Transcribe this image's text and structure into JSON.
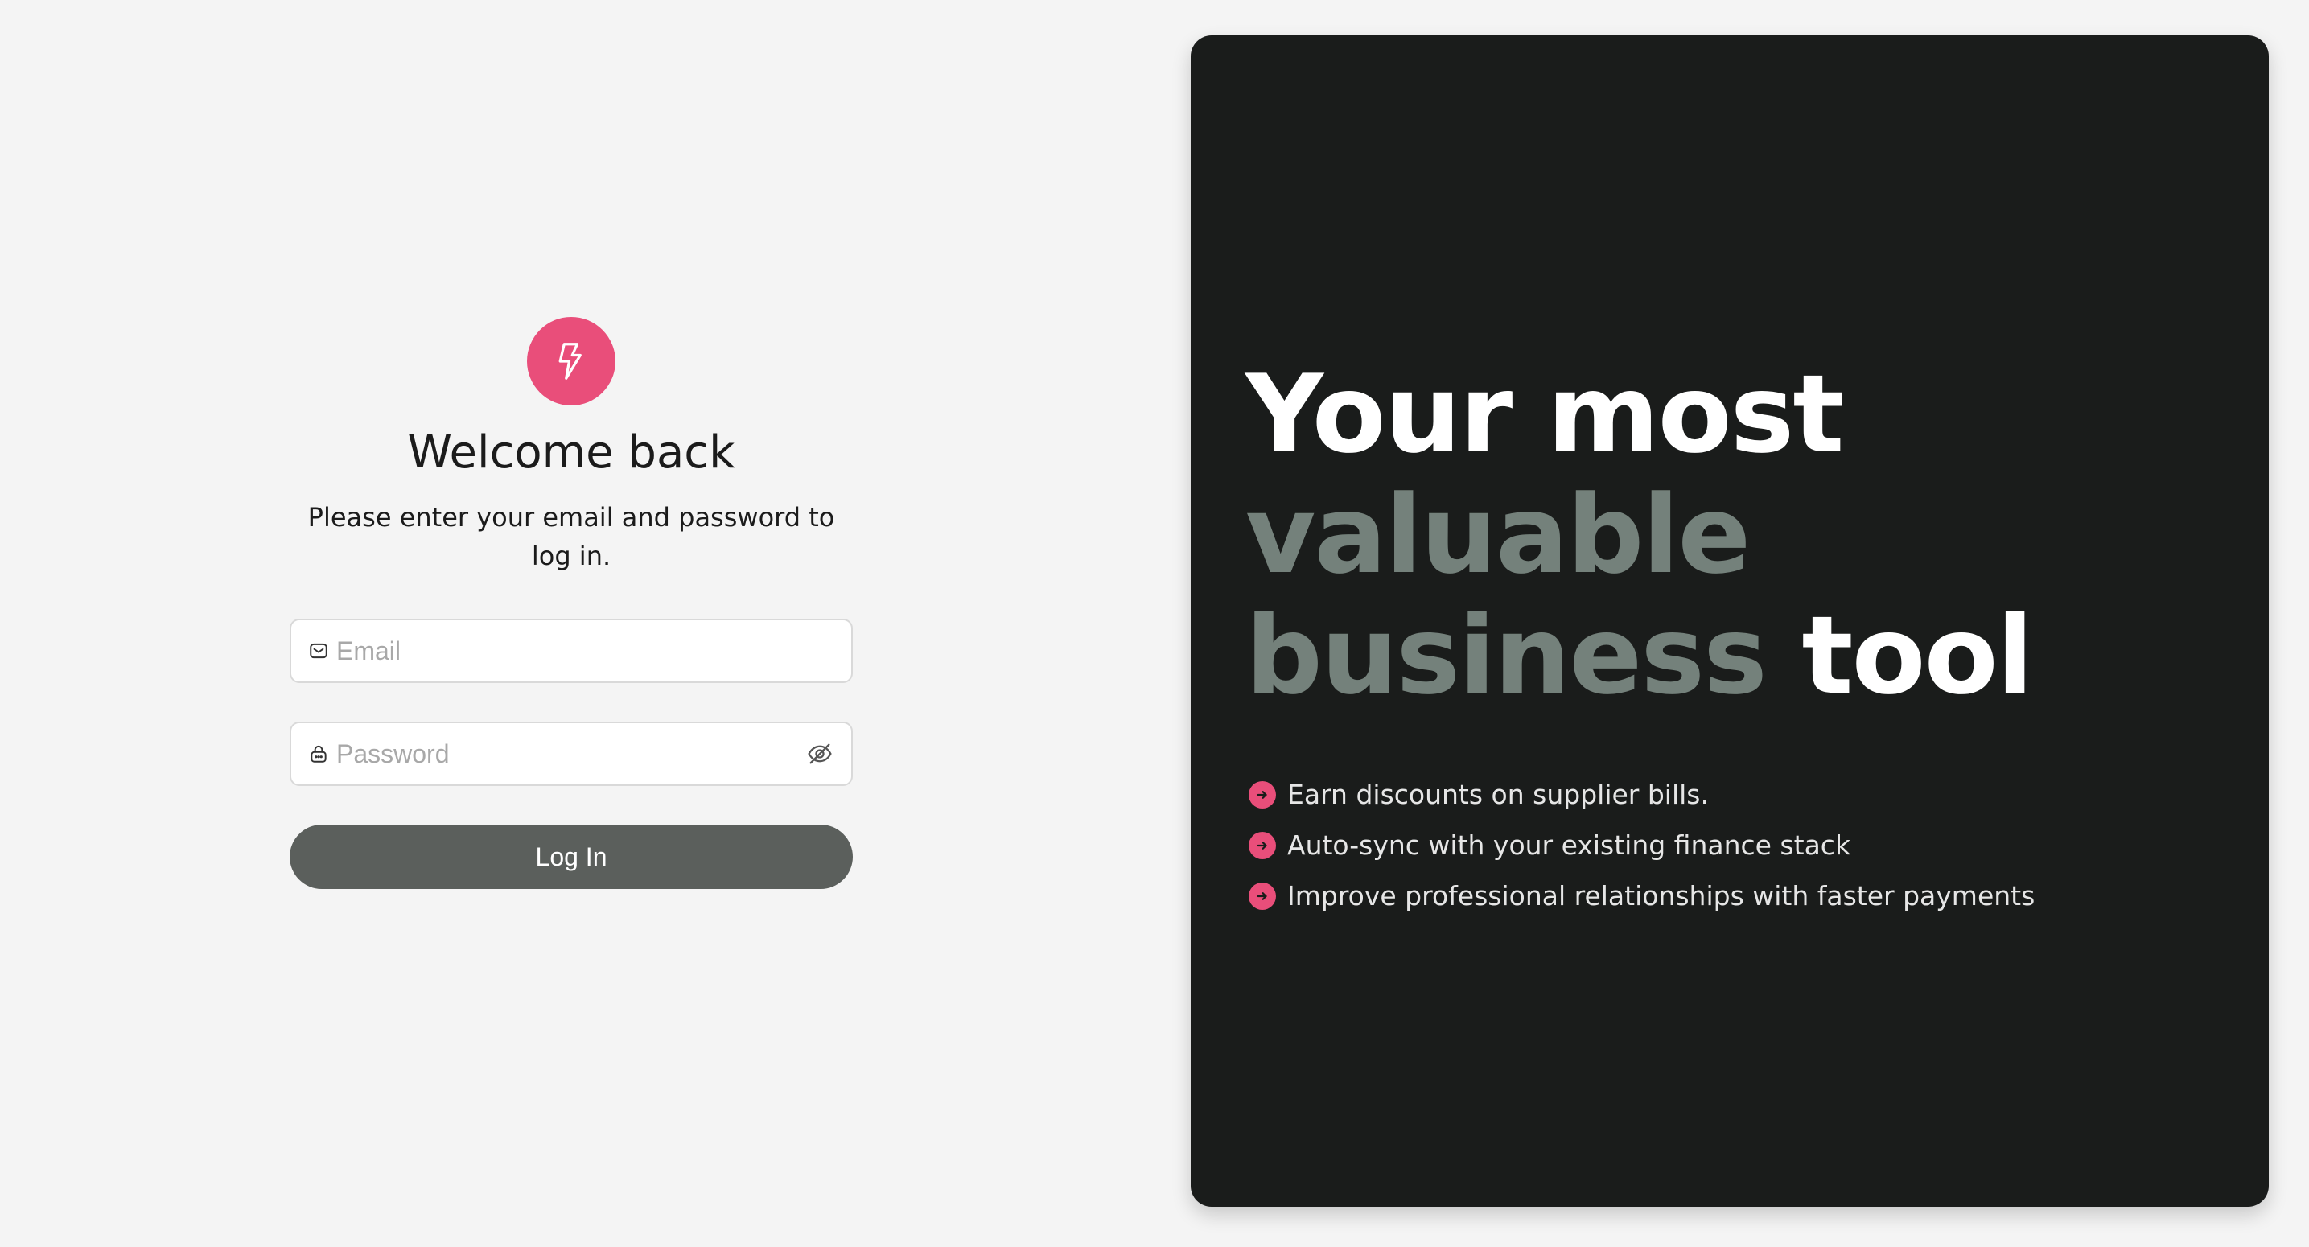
{
  "login": {
    "title": "Welcome back",
    "subtitle": "Please enter your email and password to log in.",
    "email": {
      "placeholder": "Email",
      "value": "",
      "icon": "mail-icon"
    },
    "password": {
      "placeholder": "Password",
      "value": "",
      "icon": "lock-icon",
      "toggle_icon": "eye-off-icon"
    },
    "button_label": "Log In",
    "logo_icon": "lightning-bolt-icon"
  },
  "hero": {
    "headline": {
      "line1": "Your most",
      "line2": "valuable",
      "line3_muted": "business",
      "line3_white": "tool"
    },
    "bullets": [
      {
        "text": "Earn discounts on supplier bills.",
        "icon": "arrow-right-circle-icon"
      },
      {
        "text": "Auto-sync with your existing finance stack",
        "icon": "arrow-right-circle-icon"
      },
      {
        "text": "Improve professional relationships with faster payments",
        "icon": "arrow-right-circle-icon"
      }
    ]
  },
  "colors": {
    "accent": "#e94e7a",
    "background": "#f4f4f4",
    "hero_background": "#1a1c1b",
    "headline_muted": "#74817b",
    "button_background": "#5b5f5c"
  }
}
